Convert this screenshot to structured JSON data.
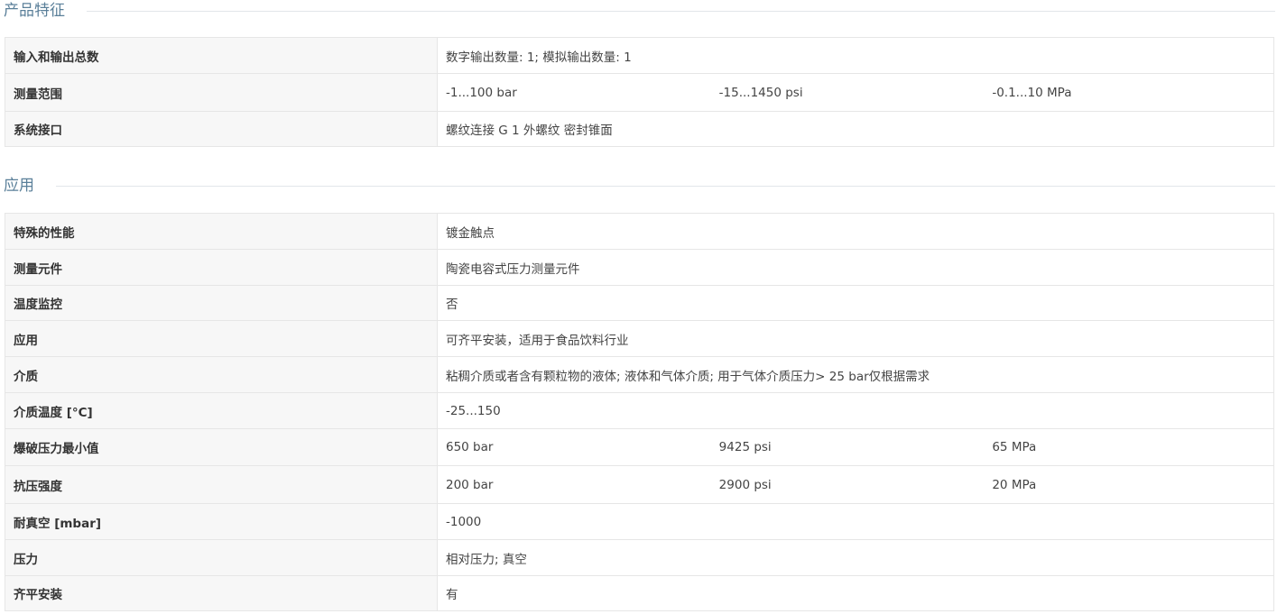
{
  "section1": {
    "title": "产品特征",
    "rows": [
      {
        "label": "输入和输出总数",
        "value": "数字输出数量: 1; 模拟输出数量: 1"
      },
      {
        "label": "测量范围",
        "values": [
          "-1...100 bar",
          "-15...1450 psi",
          "-0.1...10 MPa"
        ]
      },
      {
        "label": "系统接口",
        "value": "螺纹连接 G 1 外螺纹 密封锥面"
      }
    ]
  },
  "section2": {
    "title": "应用",
    "rows": [
      {
        "label": "特殊的性能",
        "value": "镀金触点"
      },
      {
        "label": "测量元件",
        "value": "陶瓷电容式压力测量元件"
      },
      {
        "label": "温度监控",
        "value": "否"
      },
      {
        "label": "应用",
        "value": "可齐平安装，适用于食品饮料行业"
      },
      {
        "label": "介质",
        "value": "粘稠介质或者含有颗粒物的液体; 液体和气体介质; 用于气体介质压力> 25 bar仅根据需求"
      },
      {
        "label": "介质温度 [°C]",
        "value": "-25...150"
      },
      {
        "label": "爆破压力最小值",
        "values": [
          "650 bar",
          "9425 psi",
          "65 MPa"
        ]
      },
      {
        "label": "抗压强度",
        "values": [
          "200 bar",
          "2900 psi",
          "20 MPa"
        ]
      },
      {
        "label": "耐真空 [mbar]",
        "value": "-1000"
      },
      {
        "label": "压力",
        "value": "相对压力; 真空"
      },
      {
        "label": "齐平安装",
        "value": "有"
      }
    ]
  }
}
